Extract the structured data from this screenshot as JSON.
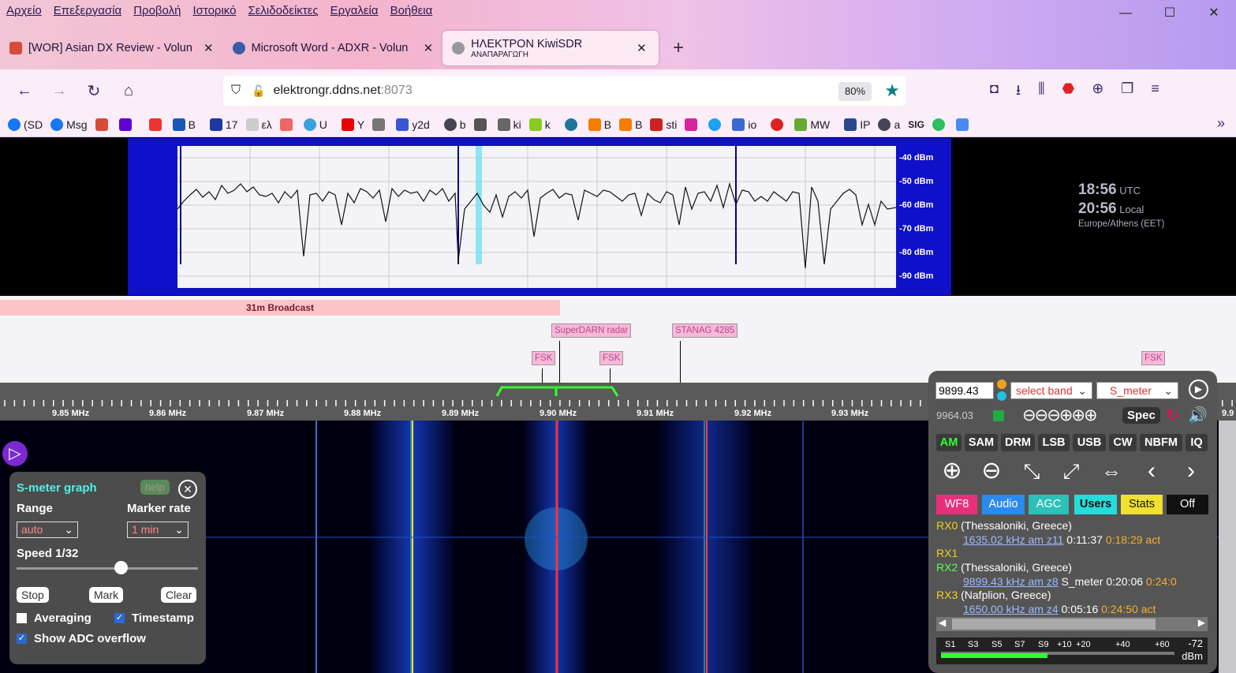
{
  "browser": {
    "menu": [
      "Αρχείο",
      "Επεξεργασία",
      "Προβολή",
      "Ιστορικό",
      "Σελιδοδείκτες",
      "Εργαλεία",
      "Βοήθεια"
    ],
    "tabs": [
      {
        "label": "[WOR] Asian DX Review - Volun",
        "close": "✕",
        "color": "#d84b3a"
      },
      {
        "label": "Microsoft Word - ADXR - Volun",
        "close": "✕",
        "color": "#3a5ca8"
      },
      {
        "label": "ΗΛΕΚΤΡΟΝ KiwiSDR",
        "sublabel": "ΑΝΑΠΑΡΑΓΩΓΗ",
        "close": "✕",
        "color": "#888888"
      }
    ],
    "new_tab": "+",
    "url_host": "elektrongr.ddns.net",
    "url_port": ":8073",
    "zoom": "80%",
    "bookmarks": [
      "(SD",
      "Msg",
      "",
      "",
      "",
      "B",
      "17",
      "ελ",
      "",
      "U",
      "Y",
      "",
      "y2d",
      "b",
      "",
      "ki",
      "k",
      "",
      "B",
      "B",
      "sti",
      "",
      "",
      "io",
      "",
      "MW",
      "IP",
      "a",
      "SIG",
      "",
      ""
    ],
    "nav_icons": [
      "back-icon",
      "forward-icon",
      "reload-icon",
      "home-icon"
    ]
  },
  "spectrum": {
    "dbm_labels": [
      "-40 dBm",
      "-50 dBm",
      "-60 dBm",
      "-70 dBm",
      "-80 dBm",
      "-90 dBm"
    ]
  },
  "clock": {
    "utc_time": "18:56",
    "utc_label": "UTC",
    "local_time": "20:56",
    "local_label": "Local",
    "tz": "Europe/Athens (EET)"
  },
  "bands": {
    "broadcast": "31m Broadcast",
    "labels": [
      "SuperDARN radar",
      "STANAG 4285",
      "FSK",
      "FSK",
      "FSK"
    ]
  },
  "scale": {
    "ticks": [
      "9.85 MHz",
      "9.86 MHz",
      "9.87 MHz",
      "9.88 MHz",
      "9.89 MHz",
      "9.90 MHz",
      "9.91 MHz",
      "9.92 MHz",
      "9.93 MHz",
      "9.9"
    ]
  },
  "smeter": {
    "title": "S-meter graph",
    "help": "help",
    "range_label": "Range",
    "marker_label": "Marker rate",
    "range_value": "auto",
    "marker_value": "1 min",
    "speed": "Speed 1/32",
    "stop": "Stop",
    "mark": "Mark",
    "clear": "Clear",
    "averaging": "Averaging",
    "timestamp": "Timestamp",
    "adc": "Show ADC overflow"
  },
  "control": {
    "freq": "9899.43",
    "band": "select band",
    "ext": "S_meter",
    "freq2": "9964.03",
    "spec": "Spec",
    "modes": [
      "AM",
      "SAM",
      "DRM",
      "LSB",
      "USB",
      "CW",
      "NBFM",
      "IQ"
    ],
    "tabs": [
      "WF8",
      "Audio",
      "AGC",
      "Users",
      "Stats",
      "Off"
    ],
    "users": [
      {
        "id": "RX0",
        "loc": "(Thessaloniki, Greece)",
        "link": "1635.02 kHz am z11",
        "t1": "0:11:37",
        "t2": "0:18:29 act"
      },
      {
        "id": "RX1",
        "loc": "",
        "link": "",
        "t1": "",
        "t2": ""
      },
      {
        "id": "RX2",
        "loc": "(Thessaloniki, Greece)",
        "link": "9899.43 kHz am z8",
        "t1": "S_meter 0:20:06",
        "t2": "0:24:0"
      },
      {
        "id": "RX3",
        "loc": "(Nafplion, Greece)",
        "link": "1650.00 kHz am z4",
        "t1": "0:05:16",
        "t2": "0:24:50 act"
      }
    ],
    "meter_labels": [
      "S1",
      "S3",
      "S5",
      "S7",
      "S9",
      "+10",
      "+20",
      "+40",
      "+60"
    ],
    "meter_value": "-72",
    "meter_unit": "dBm"
  }
}
